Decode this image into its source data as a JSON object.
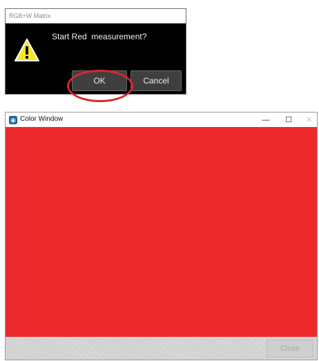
{
  "dialog": {
    "title": "RGB+W Matrix",
    "icon": "warning-icon",
    "message": "Start Red  measurement?",
    "ok_label": "OK",
    "cancel_label": "Cancel",
    "highlight_color": "#d8262c"
  },
  "color_window": {
    "title": "Color Window",
    "app_icon": "app-icon",
    "minimize_glyph": "—",
    "maximize_glyph": "☐",
    "close_glyph": "✕",
    "display_color": "#ec2a2b",
    "close_label": "Close",
    "close_enabled": false
  }
}
